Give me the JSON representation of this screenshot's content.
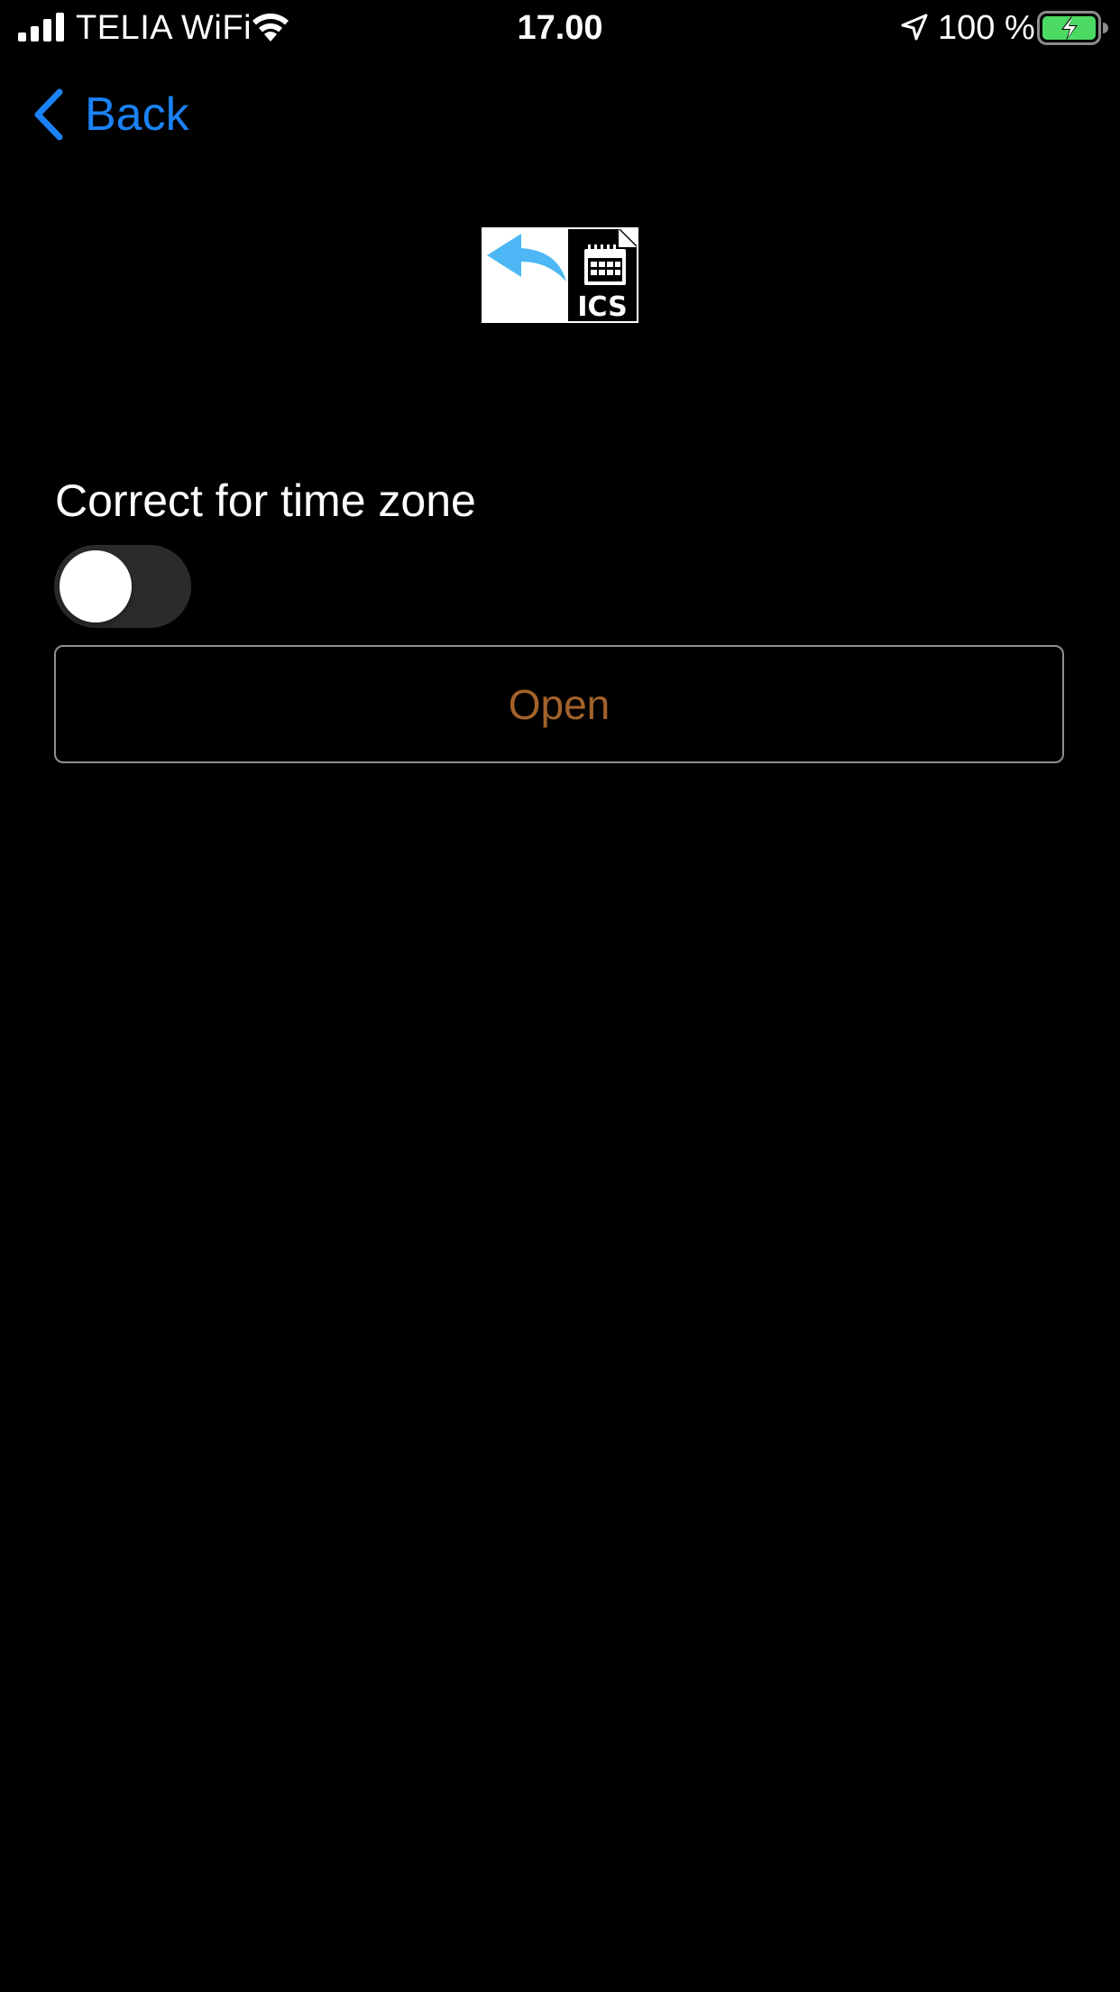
{
  "status_bar": {
    "carrier": "TELIA WiFi",
    "time": "17.00",
    "battery_percent": "100 %",
    "battery_level": 1.0,
    "battery_charging": true,
    "icons": [
      "signal-icon",
      "wifi-icon",
      "location-arrow-icon",
      "battery-icon"
    ]
  },
  "nav": {
    "back_label": "Back",
    "back_icon": "chevron-left-icon",
    "accent_color": "#1a82f6"
  },
  "app_icon": {
    "icon": "ics-import-icon",
    "text": "ICS"
  },
  "settings": {
    "correct_time_zone_label": "Correct for time zone",
    "correct_time_zone_on": false
  },
  "actions": {
    "open_label": "Open",
    "open_color": "#a3622a"
  }
}
